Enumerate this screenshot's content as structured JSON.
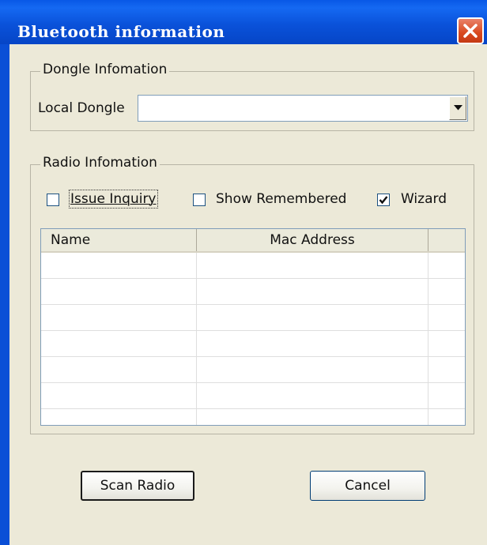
{
  "window": {
    "title": "Bluetooth information"
  },
  "dongle_group": {
    "legend": "Dongle Infomation",
    "local_dongle_label": "Local Dongle",
    "local_dongle_value": ""
  },
  "radio_group": {
    "legend": "Radio Infomation",
    "checkboxes": [
      {
        "label": "Issue Inquiry",
        "checked": false
      },
      {
        "label": "Show Remembered",
        "checked": false
      },
      {
        "label": "Wizard",
        "checked": true
      }
    ],
    "list": {
      "columns": [
        "Name",
        "Mac Address"
      ],
      "rows": []
    }
  },
  "buttons": {
    "scan": "Scan Radio",
    "cancel": "Cancel"
  },
  "icons": {
    "close": "close-icon",
    "dropdown": "chevron-down-icon",
    "check": "checkmark-icon"
  },
  "colors": {
    "title_bar": "#0a52da",
    "close_button": "#d9481e",
    "dialog_face": "#ece9d8"
  }
}
